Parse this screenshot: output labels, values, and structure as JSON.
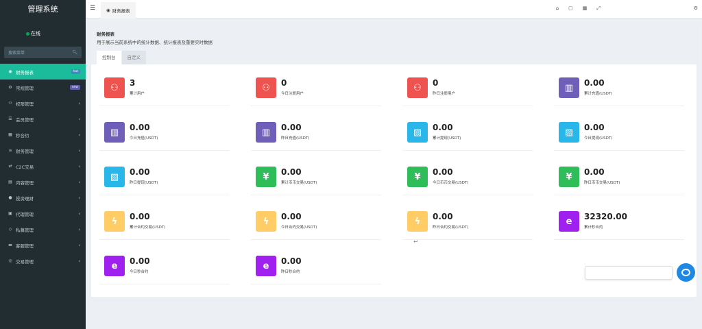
{
  "brand": "管理系统",
  "user": {
    "status": "在线"
  },
  "search": {
    "placeholder": "搜索菜单"
  },
  "sidebar": {
    "items": [
      {
        "label": "财务报表",
        "icon": "dashboard-icon",
        "badge": "hot",
        "active": true
      },
      {
        "label": "常规管理",
        "icon": "gears-icon",
        "badge": "new"
      },
      {
        "label": "权限管理",
        "icon": "users-icon"
      },
      {
        "label": "会员管理",
        "icon": "list-icon"
      },
      {
        "label": "秒合约",
        "icon": "calendar-icon"
      },
      {
        "label": "财务管理",
        "icon": "database-icon"
      },
      {
        "label": "C2C交易",
        "icon": "c2c-icon"
      },
      {
        "label": "内容管理",
        "icon": "content-icon"
      },
      {
        "label": "投资理财",
        "icon": "invest-icon"
      },
      {
        "label": "代理管理",
        "icon": "briefcase-icon"
      },
      {
        "label": "私募管理",
        "icon": "diamond-icon"
      },
      {
        "label": "客服管理",
        "icon": "chat-icon"
      },
      {
        "label": "交易管理",
        "icon": "eye-icon"
      }
    ]
  },
  "topbar": {
    "tab_label": "财务报表"
  },
  "panel": {
    "title": "财务报表",
    "desc": "用于展示当前系统中的统计数据、统计报表及重要实时数据",
    "tabs": [
      "控制台",
      "自定义"
    ]
  },
  "stats": [
    {
      "value": "3",
      "label": "累计用户",
      "icon": "users-icon",
      "color": "#ef5350"
    },
    {
      "value": "0",
      "label": "今日注册用户",
      "icon": "users-icon",
      "color": "#ef5350"
    },
    {
      "value": "0",
      "label": "昨日注册用户",
      "icon": "users-icon",
      "color": "#ef5350"
    },
    {
      "value": "0.00",
      "label": "累计充值(USDT)",
      "icon": "book-icon",
      "color": "#6f5fb8"
    },
    {
      "value": "0.00",
      "label": "今日充值(USDT)",
      "icon": "book-icon",
      "color": "#6f5fb8"
    },
    {
      "value": "0.00",
      "label": "昨日充值(USDT)",
      "icon": "book-icon",
      "color": "#6f5fb8"
    },
    {
      "value": "0.00",
      "label": "累计提现(USDT)",
      "icon": "bag-icon",
      "color": "#29b6e8"
    },
    {
      "value": "0.00",
      "label": "今日提现(USDT)",
      "icon": "bag-icon",
      "color": "#29b6e8"
    },
    {
      "value": "0.00",
      "label": "昨日提现(USDT)",
      "icon": "bag-icon",
      "color": "#29b6e8"
    },
    {
      "value": "0.00",
      "label": "累计币币交易(USDT)",
      "icon": "yen-icon",
      "color": "#2ebd59"
    },
    {
      "value": "0.00",
      "label": "今日币币交易(USDT)",
      "icon": "yen-icon",
      "color": "#2ebd59"
    },
    {
      "value": "0.00",
      "label": "昨日币币交易(USDT)",
      "icon": "yen-icon",
      "color": "#2ebd59"
    },
    {
      "value": "0.00",
      "label": "累计合约交易(USDT)",
      "icon": "bolt-icon",
      "color": "#ffcc66"
    },
    {
      "value": "0.00",
      "label": "今日合约交易(USDT)",
      "icon": "bolt-icon",
      "color": "#ffcc66"
    },
    {
      "value": "0.00",
      "label": "昨日合约交易(USDT)",
      "icon": "bolt-icon",
      "color": "#ffcc66"
    },
    {
      "value": "32320.00",
      "label": "累计秒合约",
      "icon": "ie-icon",
      "color": "#a020f0"
    },
    {
      "value": "0.00",
      "label": "今日秒合约",
      "icon": "ie-icon",
      "color": "#a020f0"
    },
    {
      "value": "0.00",
      "label": "昨日秒合约",
      "icon": "ie-icon",
      "color": "#a020f0"
    }
  ]
}
